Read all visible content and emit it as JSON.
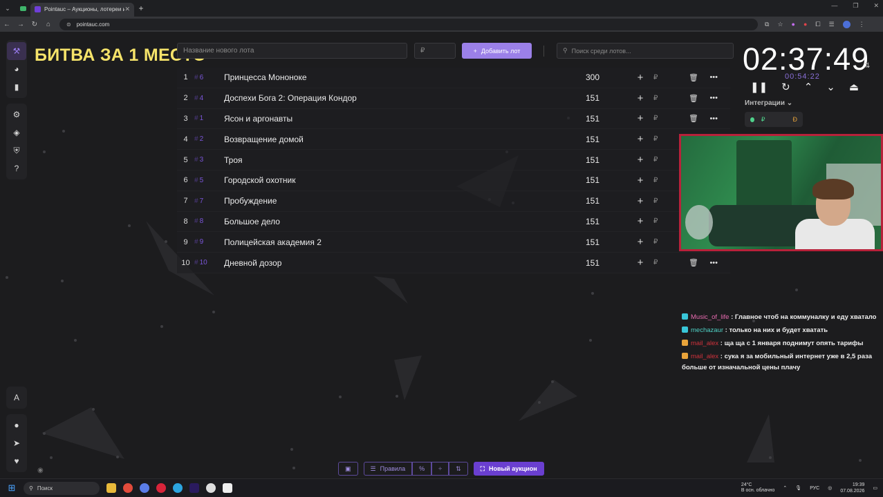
{
  "browser": {
    "tab_title": "Pointauc – Аукционы, лотереи и ...",
    "url": "pointauc.com"
  },
  "overlay_title": "БИТВА ЗА 1 МЕСТО",
  "controls": {
    "new_lot_placeholder": "Название нового лота",
    "price_placeholder": "₽",
    "add_button": "Добавить лот",
    "search_placeholder": "Поиск среди лотов..."
  },
  "lots": [
    {
      "num": "1",
      "id": "6",
      "name": "Принцесса Мононоке",
      "amount": "300",
      "deletable": true
    },
    {
      "num": "2",
      "id": "4",
      "name": "Доспехи Бога 2: Операция Кондор",
      "amount": "151",
      "deletable": true
    },
    {
      "num": "3",
      "id": "1",
      "name": "Ясон и аргонавты",
      "amount": "151",
      "deletable": true
    },
    {
      "num": "4",
      "id": "2",
      "name": "Возвращение домой",
      "amount": "151",
      "deletable": false
    },
    {
      "num": "5",
      "id": "3",
      "name": "Троя",
      "amount": "151",
      "deletable": false
    },
    {
      "num": "6",
      "id": "5",
      "name": "Городской охотник",
      "amount": "151",
      "deletable": false
    },
    {
      "num": "7",
      "id": "7",
      "name": "Пробуждение",
      "amount": "151",
      "deletable": false
    },
    {
      "num": "8",
      "id": "8",
      "name": "Большое дело",
      "amount": "151",
      "deletable": false
    },
    {
      "num": "9",
      "id": "9",
      "name": "Полицейская академия 2",
      "amount": "151",
      "deletable": false
    },
    {
      "num": "10",
      "id": "10",
      "name": "Дневной дозор",
      "amount": "151",
      "deletable": true
    }
  ],
  "timer": {
    "main": "02:37:49",
    "sub": "00:54:22",
    "integrations_label": "Интеграции"
  },
  "chat": [
    {
      "user": "Music_of_life",
      "color": "#e86bb0",
      "badge": "#39c6d8",
      "text": "Главное чтоб на коммуналку и еду хватало"
    },
    {
      "user": "mechazaur",
      "color": "#4fd1c5",
      "badge": "#39c6d8",
      "text": "только на них и будет хватать"
    },
    {
      "user": "mail_alex",
      "color": "#d0323c",
      "badge": "#e8a33a",
      "text": "ща ща с 1 января поднимут опять тарифы"
    },
    {
      "user": "mail_alex",
      "color": "#d0323c",
      "badge": "#e8a33a",
      "text": "сука я за мобильный интернет уже в 2,5 раза больше от изначальной цены плачу"
    }
  ],
  "bottom_toolbar": {
    "rules": "Правила",
    "new_auction": "Новый аукцион"
  },
  "taskbar": {
    "search": "Поиск",
    "temp": "24°C",
    "weather": "В осн. облачно",
    "lang": "РУС",
    "time": "19:39",
    "date": "07.08.2026"
  },
  "colors": {
    "accent": "#9b80e8",
    "timer_sub": "#8a6fd8",
    "overlay_title": "#f5e36a"
  }
}
